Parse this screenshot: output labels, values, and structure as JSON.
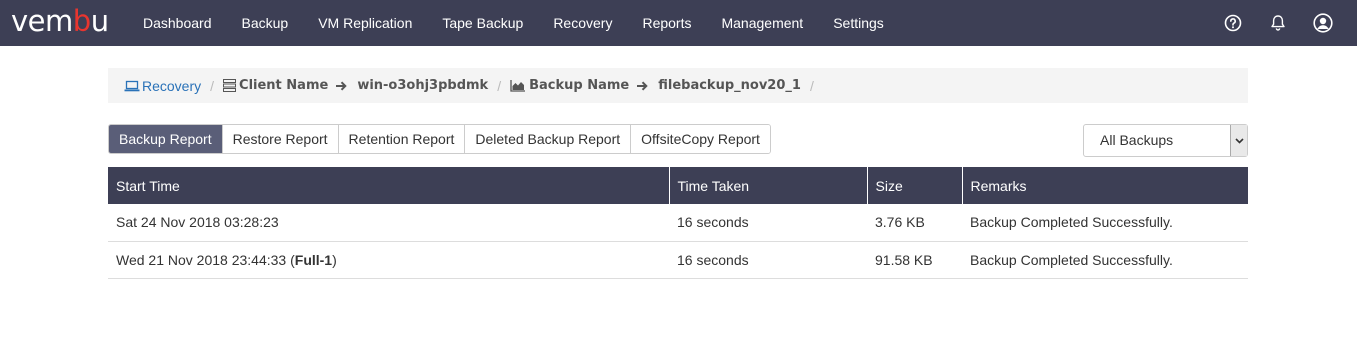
{
  "app": {
    "logo_main": "vem",
    "logo_accent": "b",
    "logo_end": "u"
  },
  "nav": {
    "items": [
      "Dashboard",
      "Backup",
      "VM Replication",
      "Tape Backup",
      "Recovery",
      "Reports",
      "Management",
      "Settings"
    ]
  },
  "top_icons": [
    "help-icon",
    "bell-icon",
    "user-icon"
  ],
  "breadcrumb": {
    "recovery": "Recovery",
    "client_label": "Client Name",
    "client_value": "win-o3ohj3pbdmk",
    "backup_label": "Backup Name",
    "backup_value": "filebackup_nov20_1",
    "separator": "/"
  },
  "tabs": [
    {
      "label": "Backup Report",
      "active": true
    },
    {
      "label": "Restore Report",
      "active": false
    },
    {
      "label": "Retention Report",
      "active": false
    },
    {
      "label": "Deleted Backup Report",
      "active": false
    },
    {
      "label": "OffsiteCopy Report",
      "active": false
    }
  ],
  "filter": {
    "selected": "All Backups"
  },
  "table": {
    "headers": [
      "Start Time",
      "Time Taken",
      "Size",
      "Remarks"
    ],
    "rows": [
      {
        "start_time": "Sat 24 Nov 2018 03:28:23",
        "tag": "",
        "time_taken": "16 seconds",
        "size": "3.76 KB",
        "remarks": "Backup Completed Successfully."
      },
      {
        "start_time": "Wed 21 Nov 2018 23:44:33 (",
        "tag": "Full-1",
        "tag_close": ")",
        "time_taken": "16 seconds",
        "size": "91.58 KB",
        "remarks": "Backup Completed Successfully."
      }
    ]
  },
  "colors": {
    "topbar": "#3d3f55",
    "active_tab": "#5a5e78",
    "link": "#2a72b8",
    "brand_accent": "#e8352f"
  }
}
